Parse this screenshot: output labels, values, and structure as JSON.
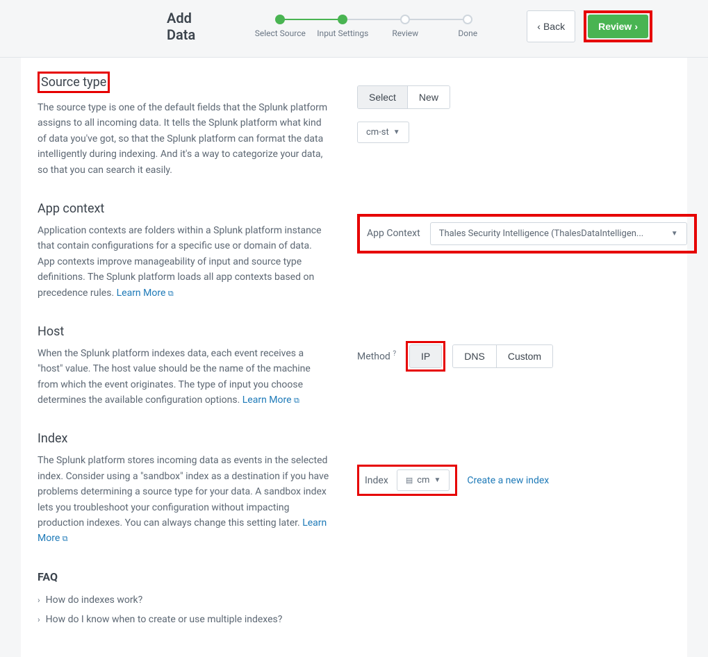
{
  "header": {
    "title": "Add Data",
    "steps": [
      "Select Source",
      "Input Settings",
      "Review",
      "Done"
    ],
    "back_label": "Back",
    "review_label": "Review"
  },
  "source_type": {
    "heading": "Source type",
    "description": "The source type is one of the default fields that the Splunk platform assigns to all incoming data. It tells the Splunk platform what kind of data you've got, so that the Splunk platform can format the data intelligently during indexing. And it's a way to categorize your data, so that you can search it easily.",
    "tab_select": "Select",
    "tab_new": "New",
    "selected_value": "cm-st"
  },
  "app_context": {
    "heading": "App context",
    "description_prefix": "Application contexts are folders within a Splunk platform instance that contain configurations for a specific use or domain of data. App contexts improve manageability of input and source type definitions. The Splunk platform loads all app contexts based on precedence rules. ",
    "learn_more": "Learn More",
    "field_label": "App Context",
    "selected_value": "Thales Security Intelligence (ThalesDataIntelligen..."
  },
  "host": {
    "heading": "Host",
    "description_prefix": "When the Splunk platform indexes data, each event receives a \"host\" value. The host value should be the name of the machine from which the event originates. The type of input you choose determines the available configuration options. ",
    "learn_more": "Learn More",
    "method_label": "Method",
    "options": [
      "IP",
      "DNS",
      "Custom"
    ]
  },
  "index": {
    "heading": "Index",
    "description_prefix": "The Splunk platform stores incoming data as events in the selected index. Consider using a \"sandbox\" index as a destination if you have problems determining a source type for your data. A sandbox index lets you troubleshoot your configuration without impacting production indexes. You can always change this setting later. ",
    "learn_more": "Learn More",
    "field_label": "Index",
    "selected_value": "cm",
    "create_link": "Create a new index"
  },
  "faq": {
    "heading": "FAQ",
    "items": [
      "How do indexes work?",
      "How do I know when to create or use multiple indexes?"
    ]
  }
}
